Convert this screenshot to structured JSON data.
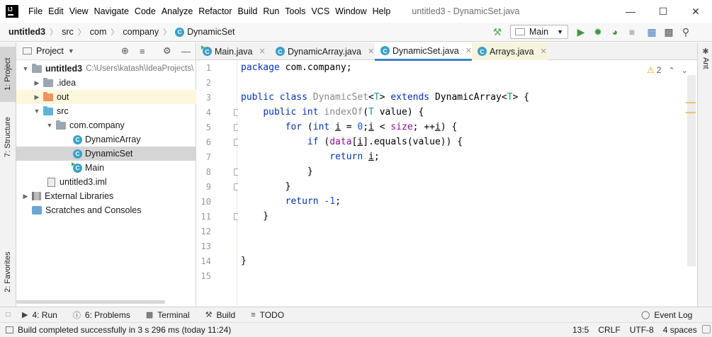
{
  "window": {
    "title": "untitled3 - DynamicSet.java"
  },
  "menu": [
    "File",
    "Edit",
    "View",
    "Navigate",
    "Code",
    "Analyze",
    "Refactor",
    "Build",
    "Run",
    "Tools",
    "VCS",
    "Window",
    "Help"
  ],
  "breadcrumb": [
    "untitled3",
    "src",
    "com",
    "company",
    "DynamicSet"
  ],
  "run_config": "Main",
  "project_panel": {
    "title": "Project",
    "tree": [
      {
        "label": "untitled3",
        "path": "C:\\Users\\katash\\IdeaProjects\\"
      },
      {
        "label": ".idea"
      },
      {
        "label": "out"
      },
      {
        "label": "src"
      },
      {
        "label": "com.company"
      },
      {
        "label": "DynamicArray"
      },
      {
        "label": "DynamicSet"
      },
      {
        "label": "Main"
      },
      {
        "label": "untitled3.iml"
      },
      {
        "label": "External Libraries"
      },
      {
        "label": "Scratches and Consoles"
      }
    ]
  },
  "left_stripe": [
    "1: Project",
    "7: Structure",
    "2: Favorites"
  ],
  "right_stripe": [
    "Ant"
  ],
  "editor_tabs": [
    "Main.java",
    "DynamicArray.java",
    "DynamicSet.java",
    "Arrays.java"
  ],
  "inspection": {
    "warnings": "2"
  },
  "line_numbers": [
    "1",
    "2",
    "3",
    "4",
    "5",
    "6",
    "7",
    "8",
    "9",
    "10",
    "11",
    "12",
    "13",
    "14",
    "15"
  ],
  "code_lines": [
    "package com.company;",
    "",
    "public class DynamicSet<T> extends DynamicArray<T> {",
    "    public int indexOf(T value) {",
    "        for (int i = 0;i < size; ++i) {",
    "            if (data[i].equals(value)) {",
    "                return i;",
    "            }",
    "        }",
    "        return -1;",
    "    }",
    "",
    "",
    "}",
    ""
  ],
  "bottom_tools": [
    {
      "label": "4: Run"
    },
    {
      "label": "6: Problems"
    },
    {
      "label": "Terminal"
    },
    {
      "label": "Build"
    },
    {
      "label": "TODO"
    },
    {
      "label": "Event Log"
    }
  ],
  "status": {
    "message": "Build completed successfully in 3 s 296 ms (today 11:24)",
    "position": "13:5",
    "line_sep": "CRLF",
    "encoding": "UTF-8",
    "indent": "4 spaces"
  }
}
